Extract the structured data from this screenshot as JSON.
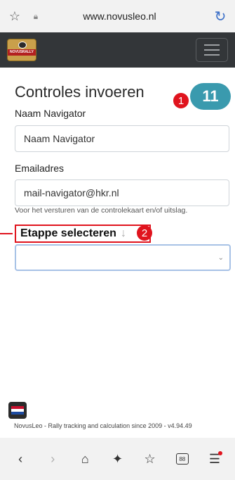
{
  "browser": {
    "url": "www.novusleo.nl",
    "icons": {
      "bookmark": "star-outline-icon",
      "lock": "lock-icon",
      "reload": "reload-icon"
    }
  },
  "site": {
    "logo_text": "NOVUSRALLY",
    "menu_icon": "hamburger-icon"
  },
  "form": {
    "title": "Controles invoeren",
    "step1_marker": "1",
    "counter": "11",
    "navigator_label": "Naam Navigator",
    "navigator_value": "Naam Navigator",
    "email_label": "Emailadres",
    "email_value": "mail-navigator@hkr.nl",
    "email_help": "Voor het versturen van de controlekaart en/of uitslag.",
    "stage_label": "Etappe selecteren",
    "stage_arrow": "↓",
    "step2_marker": "2",
    "stage_select_value": "",
    "select_chevron": "⌄"
  },
  "footer": {
    "text": "NovusLeo - Rally tracking and calculation since 2009 - v4.94.49"
  },
  "bottom_bar": {
    "back": "‹",
    "forward": "›",
    "home": "⌂",
    "sparkle": "✦",
    "favorites": "☆",
    "tabs_count": "88",
    "menu": "☰"
  },
  "colors": {
    "header_bg": "#333639",
    "counter_bg": "#3a9aae",
    "marker_red": "#e0141e",
    "select_border": "#a7c2e6"
  }
}
